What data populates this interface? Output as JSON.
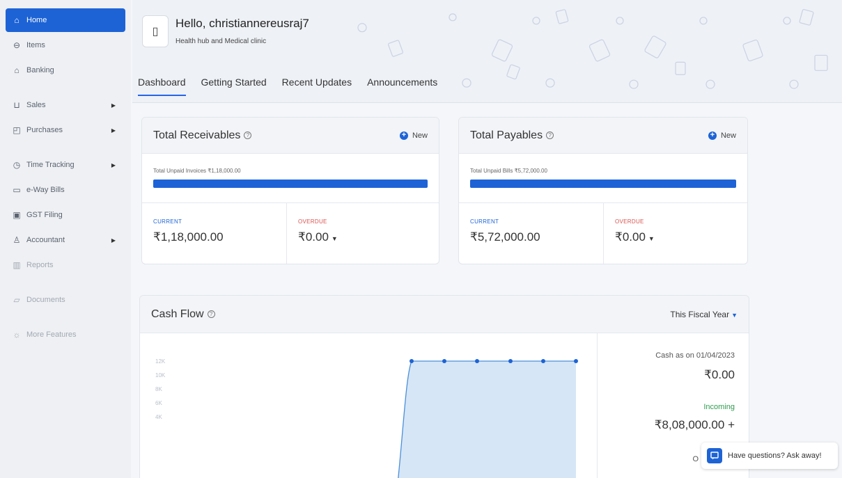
{
  "sidebar": {
    "items": [
      {
        "label": "Home",
        "icon": "home-icon"
      },
      {
        "label": "Items",
        "icon": "items-icon"
      },
      {
        "label": "Banking",
        "icon": "bank-icon"
      },
      {
        "label": "Sales",
        "icon": "cart-icon"
      },
      {
        "label": "Purchases",
        "icon": "bag-icon"
      },
      {
        "label": "Time Tracking",
        "icon": "clock-icon"
      },
      {
        "label": "e-Way Bills",
        "icon": "truck-icon"
      },
      {
        "label": "GST Filing",
        "icon": "document-icon"
      },
      {
        "label": "Accountant",
        "icon": "user-icon"
      },
      {
        "label": "Reports",
        "icon": "chart-icon"
      },
      {
        "label": "Documents",
        "icon": "folder-icon"
      },
      {
        "label": "More Features",
        "icon": "more-icon"
      }
    ]
  },
  "header": {
    "greeting": "Hello, christiannereusraj7",
    "org": "Health hub and Medical clinic",
    "tabs": [
      "Dashboard",
      "Getting Started",
      "Recent Updates",
      "Announcements"
    ]
  },
  "receivables": {
    "title": "Total Receivables",
    "new_label": "New",
    "unpaid": "Total Unpaid Invoices ₹1,18,000.00",
    "bar_fill": 1.0,
    "current_label": "CURRENT",
    "current": "₹1,18,000.00",
    "overdue_label": "OVERDUE",
    "overdue": "₹0.00"
  },
  "payables": {
    "title": "Total Payables",
    "new_label": "New",
    "unpaid": "Total Unpaid Bills ₹5,72,000.00",
    "bar_fill": 1.0,
    "current_label": "CURRENT",
    "current": "₹5,72,000.00",
    "overdue_label": "OVERDUE",
    "overdue": "₹0.00"
  },
  "cashflow": {
    "title": "Cash Flow",
    "range": "This Fiscal Year",
    "cash_as_on": "Cash as on 01/04/2023",
    "cash_amount": "₹0.00",
    "incoming_label": "Incoming",
    "incoming_amount": "₹8,08,000.00",
    "incoming_sign": "+",
    "outgoing_initial": "O"
  },
  "chart_data": {
    "type": "area",
    "yticks": [
      "12K",
      "10K",
      "8K",
      "6K",
      "4K"
    ],
    "ylim": [
      4000,
      12000
    ],
    "series": [
      {
        "values": [
          0,
          12000,
          12000,
          12000,
          12000,
          12000,
          12000
        ]
      }
    ]
  },
  "help": {
    "text": "Have questions? Ask away!"
  },
  "colors": {
    "accent": "#1d63d6",
    "incoming": "#2e9b4e",
    "overdue": "#d9534f"
  }
}
